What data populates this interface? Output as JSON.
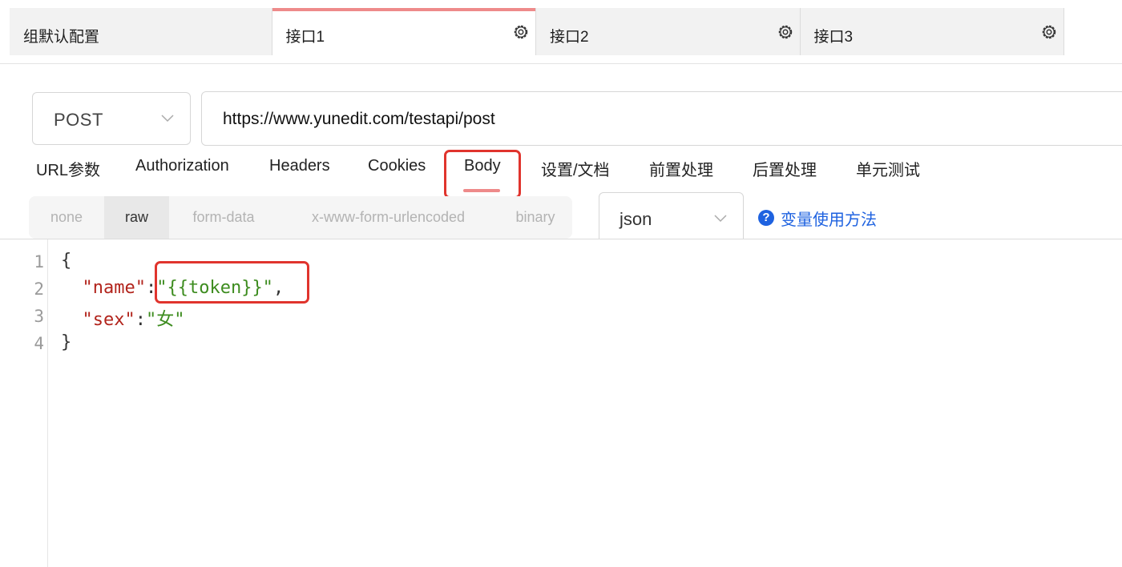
{
  "tabs": [
    {
      "label": "组默认配置",
      "active": false,
      "has_settings": false
    },
    {
      "label": "接口1",
      "active": true,
      "has_settings": true
    },
    {
      "label": "接口2",
      "active": false,
      "has_settings": true
    },
    {
      "label": "接口3",
      "active": false,
      "has_settings": true
    }
  ],
  "request": {
    "method": "POST",
    "url": "https://www.yunedit.com/testapi/post"
  },
  "subtabs": [
    "URL参数",
    "Authorization",
    "Headers",
    "Cookies",
    "Body",
    "设置/文档",
    "前置处理",
    "后置处理",
    "单元测试"
  ],
  "active_subtab": "Body",
  "body_types": [
    "none",
    "raw",
    "form-data",
    "x-www-form-urlencoded",
    "binary"
  ],
  "active_body_type": "raw",
  "format": "json",
  "help_link": "变量使用方法",
  "editor": {
    "line_numbers": [
      "1",
      "2",
      "3",
      "4"
    ],
    "brace_open": "{",
    "brace_close": "}",
    "line2": {
      "key": "\"name\"",
      "colon": ":",
      "value": "\"{{token}}\"",
      "comma": ","
    },
    "line3": {
      "key": "\"sex\"",
      "colon": ":",
      "value": "\"女\""
    }
  },
  "colors": {
    "active_tab_indicator": "#ee8a8a",
    "highlight_box": "#e0342d",
    "json_key": "#b2241c",
    "json_string": "#3d8c1f",
    "link": "#1e62e0"
  },
  "icons": {
    "settings": "gear-icon",
    "dropdown": "chevron-down-icon",
    "help": "question-circle-icon"
  }
}
